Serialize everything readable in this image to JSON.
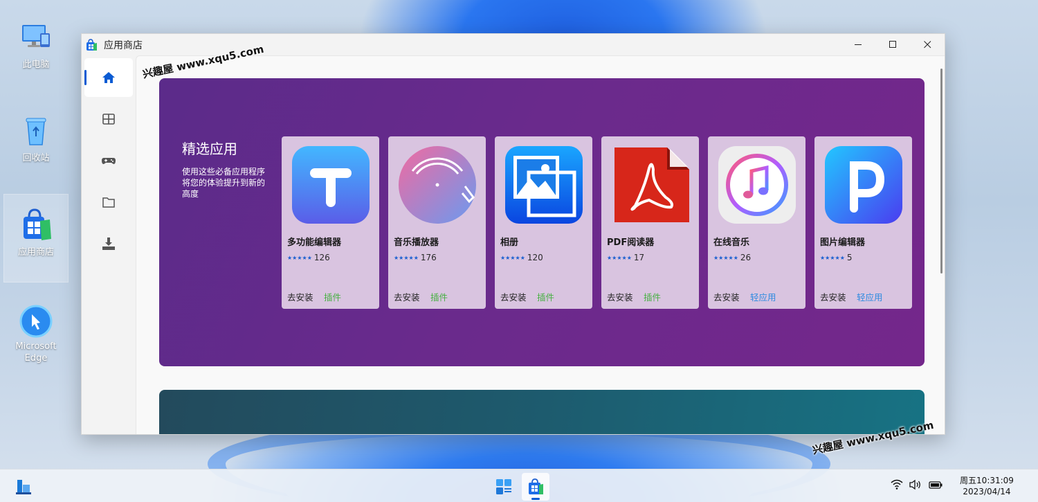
{
  "desktop": {
    "icons": [
      {
        "label": "此电脑",
        "icon": "computer-icon"
      },
      {
        "label": "回收站",
        "icon": "recycle-bin-icon"
      },
      {
        "label": "应用商店",
        "icon": "store-icon"
      },
      {
        "label": "Microsoft Edge",
        "icon": "edge-icon"
      }
    ]
  },
  "window": {
    "title": "应用商店",
    "controls": {
      "minimize": "—",
      "maximize": "☐",
      "close": "✕"
    }
  },
  "sidenav": {
    "items": [
      {
        "name": "home",
        "icon": "home-icon",
        "active": true
      },
      {
        "name": "apps",
        "icon": "apps-grid-icon",
        "active": false
      },
      {
        "name": "games",
        "icon": "gamepad-icon",
        "active": false
      },
      {
        "name": "files",
        "icon": "folder-icon",
        "active": false
      },
      {
        "name": "downloads",
        "icon": "download-icon",
        "active": false
      }
    ]
  },
  "featured": {
    "title": "精选应用",
    "description": "使用这些必备应用程序将您的体验提升到新的高度",
    "cards": [
      {
        "name": "多功能编辑器",
        "stars": "★★★★★",
        "count": "126",
        "install": "去安装",
        "tag": "插件",
        "tag_color": "green",
        "icon": "text-editor-icon"
      },
      {
        "name": "音乐播放器",
        "stars": "★★★★★",
        "count": "176",
        "install": "去安装",
        "tag": "插件",
        "tag_color": "green",
        "icon": "vinyl-record-icon"
      },
      {
        "name": "相册",
        "stars": "★★★★★",
        "count": "120",
        "install": "去安装",
        "tag": "插件",
        "tag_color": "green",
        "icon": "photo-album-icon"
      },
      {
        "name": "PDF阅读器",
        "stars": "★★★★★",
        "count": "17",
        "install": "去安装",
        "tag": "插件",
        "tag_color": "green",
        "icon": "pdf-icon"
      },
      {
        "name": "在线音乐",
        "stars": "★★★★★",
        "count": "26",
        "install": "去安装",
        "tag": "轻应用",
        "tag_color": "blue",
        "icon": "music-note-icon"
      },
      {
        "name": "图片编辑器",
        "stars": "★★★★★",
        "count": "5",
        "install": "去安装",
        "tag": "轻应用",
        "tag_color": "blue",
        "icon": "photo-editor-icon"
      }
    ]
  },
  "watermark": {
    "text": "兴趣屋 www.xqu5.com"
  },
  "taskbar": {
    "clock_time": "周五10:31:09",
    "clock_date": "2023/04/14",
    "tray_icons": [
      "wifi-icon",
      "volume-icon",
      "battery-icon"
    ]
  },
  "colors": {
    "accent": "#0a5bd3",
    "banner": "#6a2a8c",
    "card": "#d9c4e0",
    "tag_green": "#47b043",
    "tag_blue": "#2f8be0"
  }
}
